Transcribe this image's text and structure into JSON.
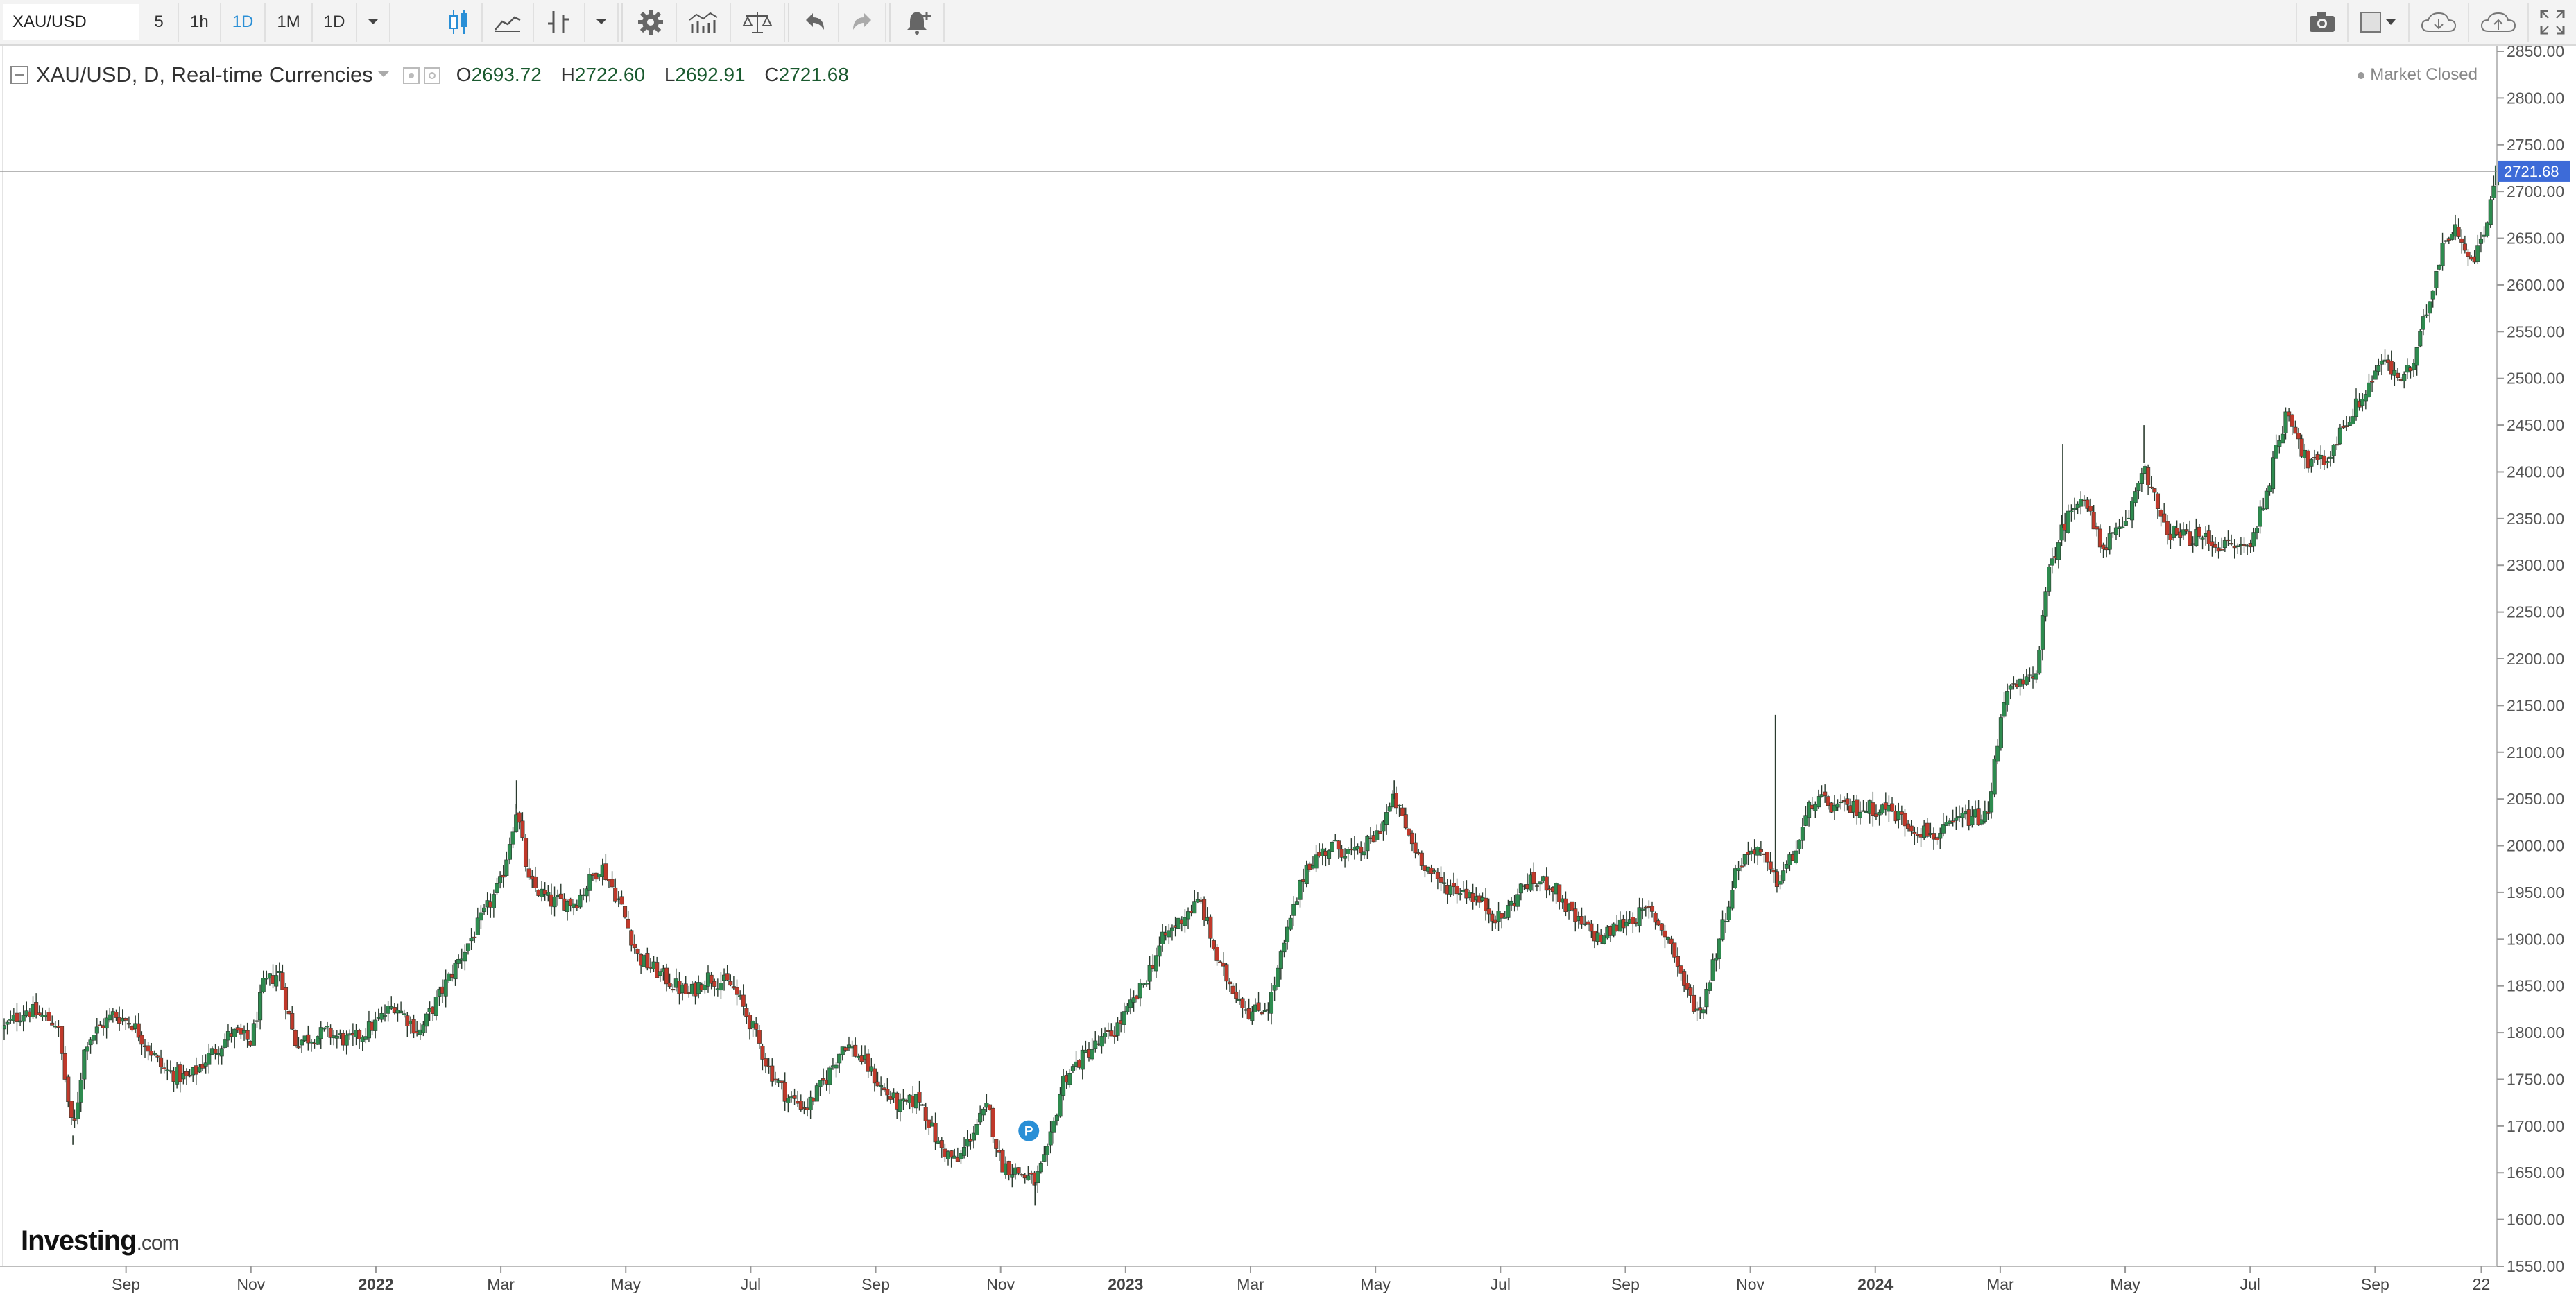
{
  "toolbar": {
    "symbol": "XAU/USD",
    "intervals": [
      "5",
      "1h",
      "1D",
      "1M",
      "1D"
    ],
    "active_interval_index": 2,
    "tools_left": [
      "candle-type-icon",
      "indicators-icon",
      "compare-icon",
      "settings-icon",
      "studies-icon",
      "scale-icon",
      "undo-icon",
      "redo-icon",
      "alert-icon"
    ],
    "tools_right": [
      "camera-icon",
      "color-swatch-icon",
      "cloud-download-icon",
      "cloud-upload-icon",
      "fullscreen-icon"
    ]
  },
  "legend": {
    "title": "XAU/USD, D, Real-time Currencies",
    "open_label": "O",
    "open": "2693.72",
    "high_label": "H",
    "high": "2722.60",
    "low_label": "L",
    "low": "2692.91",
    "close_label": "C",
    "close": "2721.68"
  },
  "market_status": "Market Closed",
  "logo": {
    "main": "Investing",
    "suffix": ".com"
  },
  "colors": {
    "up": "#2e8b4f",
    "down": "#c0392b",
    "price_tag": "#3d6bd8",
    "axis_text": "#555555"
  },
  "chart_data": {
    "type": "candlestick",
    "title": "XAU/USD, D, Real-time Currencies",
    "last_price": 2721.68,
    "ylim": [
      1550,
      2850
    ],
    "y_ticks": [
      1550,
      1600,
      1650,
      1700,
      1750,
      1800,
      1850,
      1900,
      1950,
      2000,
      2050,
      2100,
      2150,
      2200,
      2250,
      2300,
      2350,
      2400,
      2450,
      2500,
      2550,
      2600,
      2650,
      2700,
      2750,
      2800,
      2850
    ],
    "x_ticks": [
      {
        "label": "Sep",
        "bold": false,
        "t": 1
      },
      {
        "label": "Nov",
        "bold": false,
        "t": 3
      },
      {
        "label": "2022",
        "bold": true,
        "t": 5
      },
      {
        "label": "Mar",
        "bold": false,
        "t": 7
      },
      {
        "label": "May",
        "bold": false,
        "t": 9
      },
      {
        "label": "Jul",
        "bold": false,
        "t": 11
      },
      {
        "label": "Sep",
        "bold": false,
        "t": 13
      },
      {
        "label": "Nov",
        "bold": false,
        "t": 15
      },
      {
        "label": "2023",
        "bold": true,
        "t": 17
      },
      {
        "label": "Mar",
        "bold": false,
        "t": 19
      },
      {
        "label": "May",
        "bold": false,
        "t": 21
      },
      {
        "label": "Jul",
        "bold": false,
        "t": 23
      },
      {
        "label": "Sep",
        "bold": false,
        "t": 25
      },
      {
        "label": "Nov",
        "bold": false,
        "t": 27
      },
      {
        "label": "2024",
        "bold": true,
        "t": 29
      },
      {
        "label": "Mar",
        "bold": false,
        "t": 31
      },
      {
        "label": "May",
        "bold": false,
        "t": 33
      },
      {
        "label": "Jul",
        "bold": false,
        "t": 35
      },
      {
        "label": "Sep",
        "bold": false,
        "t": 37
      },
      {
        "label": "22",
        "bold": false,
        "t": 38.7
      }
    ],
    "time_range": [
      -0.95,
      38.95
    ],
    "path": [
      [
        -0.95,
        1805
      ],
      [
        -0.6,
        1825
      ],
      [
        -0.1,
        1810
      ],
      [
        0.15,
        1690
      ],
      [
        0.35,
        1790
      ],
      [
        0.8,
        1820
      ],
      [
        1.1,
        1810
      ],
      [
        1.6,
        1760
      ],
      [
        2.0,
        1750
      ],
      [
        2.4,
        1780
      ],
      [
        2.7,
        1800
      ],
      [
        3.0,
        1790
      ],
      [
        3.2,
        1850
      ],
      [
        3.45,
        1865
      ],
      [
        3.7,
        1790
      ],
      [
        4.2,
        1800
      ],
      [
        4.6,
        1790
      ],
      [
        5.0,
        1810
      ],
      [
        5.3,
        1830
      ],
      [
        5.7,
        1800
      ],
      [
        6.1,
        1850
      ],
      [
        6.6,
        1910
      ],
      [
        7.0,
        1960
      ],
      [
        7.25,
        2040
      ],
      [
        7.45,
        1960
      ],
      [
        7.8,
        1940
      ],
      [
        8.2,
        1940
      ],
      [
        8.6,
        1980
      ],
      [
        8.9,
        1940
      ],
      [
        9.2,
        1880
      ],
      [
        9.6,
        1860
      ],
      [
        10.0,
        1840
      ],
      [
        10.3,
        1860
      ],
      [
        10.7,
        1850
      ],
      [
        11.0,
        1810
      ],
      [
        11.3,
        1760
      ],
      [
        11.6,
        1730
      ],
      [
        11.9,
        1720
      ],
      [
        12.2,
        1750
      ],
      [
        12.5,
        1790
      ],
      [
        12.8,
        1770
      ],
      [
        13.1,
        1740
      ],
      [
        13.4,
        1720
      ],
      [
        13.7,
        1730
      ],
      [
        14.0,
        1680
      ],
      [
        14.3,
        1660
      ],
      [
        14.6,
        1700
      ],
      [
        14.8,
        1720
      ],
      [
        15.0,
        1660
      ],
      [
        15.3,
        1650
      ],
      [
        15.55,
        1640
      ],
      [
        15.75,
        1670
      ],
      [
        16.0,
        1750
      ],
      [
        16.4,
        1780
      ],
      [
        16.8,
        1800
      ],
      [
        17.2,
        1840
      ],
      [
        17.6,
        1900
      ],
      [
        18.0,
        1930
      ],
      [
        18.2,
        1940
      ],
      [
        18.5,
        1870
      ],
      [
        18.8,
        1840
      ],
      [
        19.0,
        1820
      ],
      [
        19.3,
        1830
      ],
      [
        19.6,
        1910
      ],
      [
        19.9,
        1980
      ],
      [
        20.3,
        2000
      ],
      [
        20.7,
        1990
      ],
      [
        21.0,
        2010
      ],
      [
        21.3,
        2050
      ],
      [
        21.6,
        2000
      ],
      [
        22.0,
        1960
      ],
      [
        22.5,
        1950
      ],
      [
        23.0,
        1920
      ],
      [
        23.4,
        1960
      ],
      [
        23.8,
        1960
      ],
      [
        24.2,
        1920
      ],
      [
        24.6,
        1900
      ],
      [
        25.0,
        1920
      ],
      [
        25.4,
        1930
      ],
      [
        25.7,
        1900
      ],
      [
        26.0,
        1840
      ],
      [
        26.2,
        1820
      ],
      [
        26.5,
        1900
      ],
      [
        26.8,
        1980
      ],
      [
        27.1,
        2000
      ],
      [
        27.4,
        1960
      ],
      [
        27.7,
        1990
      ],
      [
        28.0,
        2050
      ],
      [
        28.4,
        2040
      ],
      [
        28.8,
        2040
      ],
      [
        29.2,
        2040
      ],
      [
        29.6,
        2020
      ],
      [
        30.0,
        2010
      ],
      [
        30.4,
        2030
      ],
      [
        30.8,
        2030
      ],
      [
        31.05,
        2160
      ],
      [
        31.3,
        2170
      ],
      [
        31.55,
        2180
      ],
      [
        31.8,
        2300
      ],
      [
        32.0,
        2340
      ],
      [
        32.3,
        2380
      ],
      [
        32.6,
        2320
      ],
      [
        33.0,
        2340
      ],
      [
        33.3,
        2410
      ],
      [
        33.6,
        2340
      ],
      [
        33.9,
        2330
      ],
      [
        34.2,
        2330
      ],
      [
        34.6,
        2320
      ],
      [
        35.0,
        2320
      ],
      [
        35.3,
        2390
      ],
      [
        35.6,
        2470
      ],
      [
        35.9,
        2410
      ],
      [
        36.2,
        2410
      ],
      [
        36.5,
        2450
      ],
      [
        36.8,
        2480
      ],
      [
        37.1,
        2520
      ],
      [
        37.35,
        2500
      ],
      [
        37.6,
        2510
      ],
      [
        37.85,
        2580
      ],
      [
        38.1,
        2650
      ],
      [
        38.35,
        2660
      ],
      [
        38.55,
        2620
      ],
      [
        38.75,
        2660
      ],
      [
        38.95,
        2721.68
      ]
    ],
    "spikes": [
      {
        "t": 0.15,
        "low": 1680
      },
      {
        "t": 7.25,
        "high": 2070
      },
      {
        "t": 27.4,
        "high": 2140
      },
      {
        "t": 21.3,
        "high": 2070
      },
      {
        "t": 32.0,
        "high": 2430
      },
      {
        "t": 33.3,
        "high": 2450
      },
      {
        "t": 15.55,
        "low": 1615
      }
    ],
    "marker": {
      "t": 15.45,
      "value": 1695,
      "label": "P"
    }
  }
}
